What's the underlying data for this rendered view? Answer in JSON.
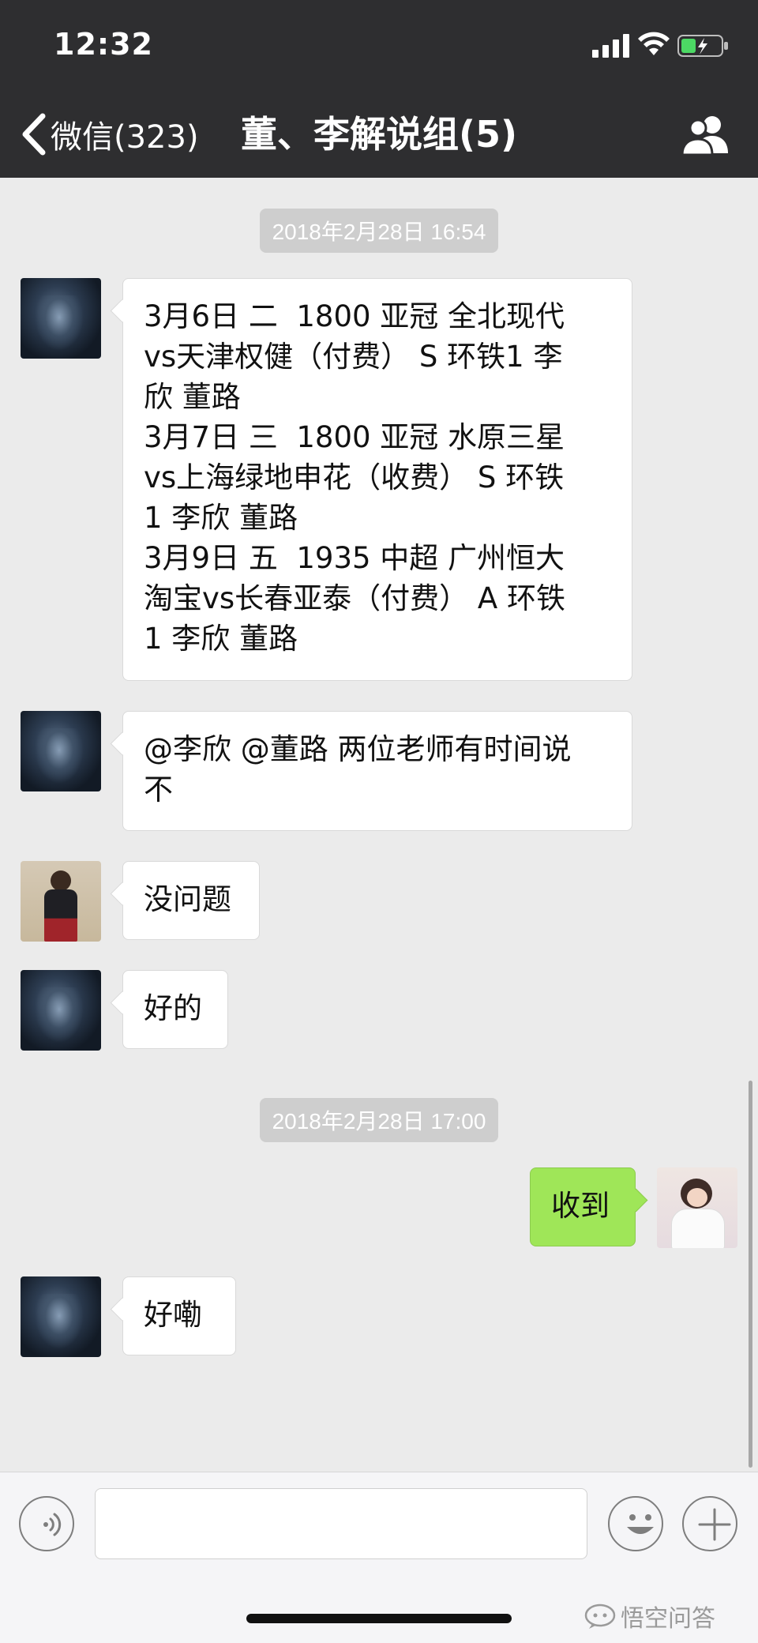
{
  "status_bar": {
    "time": "12:32"
  },
  "header": {
    "back_label": "微信(323)",
    "title": "董、李解说组(5)"
  },
  "timestamps": [
    "2018年2月28日 16:54",
    "2018年2月28日 17:00"
  ],
  "messages": [
    {
      "side": "left",
      "avatar": "armored-knight-avatar",
      "text": "3月6日 二  1800 亚冠 全北现代\nvs天津权健（付费） S 环铁1 李\n欣 董路\n3月7日 三  1800 亚冠 水原三星\nvs上海绿地申花（收费） S 环铁\n1 李欣 董路\n3月9日 五  1935 中超 广州恒大\n淘宝vs长春亚泰（付费） A 环铁\n1 李欣 董路"
    },
    {
      "side": "left",
      "avatar": "armored-knight-avatar",
      "text": "@李欣 @董路 两位老师有时间说\n不"
    },
    {
      "side": "left",
      "avatar": "fife-player-avatar",
      "text": "没问题"
    },
    {
      "side": "left",
      "avatar": "armored-knight-avatar",
      "text": "好的"
    },
    {
      "side": "right",
      "avatar": "baby-avatar",
      "text": "收到"
    },
    {
      "side": "left",
      "avatar": "armored-knight-avatar",
      "text": "好嘞"
    }
  ],
  "input_bar": {
    "text_value": "",
    "watermark": "悟空问答"
  },
  "colors": {
    "header_bg": "#2e2e30",
    "chat_bg": "#ebebeb",
    "own_bubble": "#9fe658",
    "other_bubble": "#ffffff",
    "battery_green": "#4cd964"
  }
}
